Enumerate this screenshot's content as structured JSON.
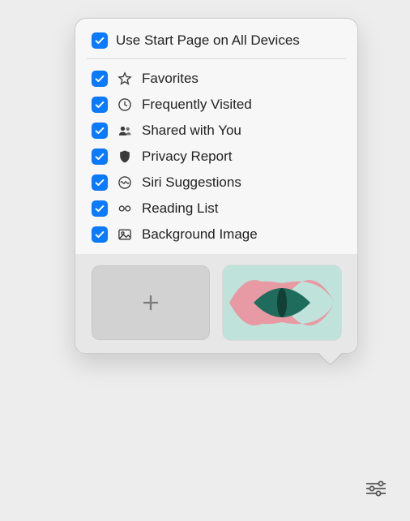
{
  "colors": {
    "accent": "#0a7aff"
  },
  "header": {
    "label": "Use Start Page on All Devices",
    "checked": true
  },
  "items": [
    {
      "icon": "star",
      "label": "Favorites",
      "checked": true
    },
    {
      "icon": "clock",
      "label": "Frequently Visited",
      "checked": true
    },
    {
      "icon": "people",
      "label": "Shared with You",
      "checked": true
    },
    {
      "icon": "shield",
      "label": "Privacy Report",
      "checked": true
    },
    {
      "icon": "siri",
      "label": "Siri Suggestions",
      "checked": true
    },
    {
      "icon": "glasses",
      "label": "Reading List",
      "checked": true
    },
    {
      "icon": "image",
      "label": "Background Image",
      "checked": true
    }
  ],
  "thumbnails": {
    "add_label": "Add background",
    "selected_index": 1
  }
}
